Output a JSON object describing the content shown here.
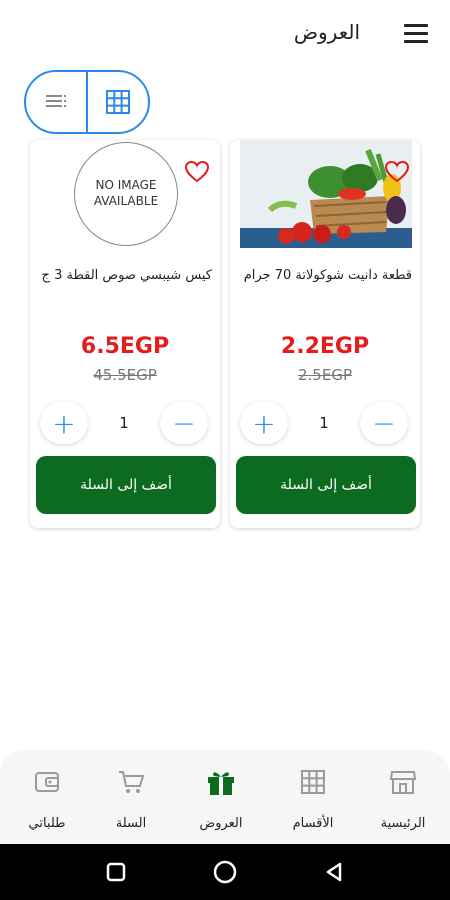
{
  "header": {
    "title": "العروض",
    "menu_icon": "menu-icon"
  },
  "view_toggle": {
    "list_icon": "list-view-icon",
    "grid_icon": "grid-view-icon",
    "active": "grid",
    "accent_color": "#2a8be6"
  },
  "products": [
    {
      "name": "كيس شيبسي صوص القطة 3 ج",
      "image_text": "NO IMAGE AVAILABLE",
      "price": "6.5EGP",
      "old_price": "45.5EGP",
      "quantity": "1",
      "add_label": "أضف إلى السلة",
      "favorite": false
    },
    {
      "name": "قطعة دانيت شوكولاتة 70 جرام",
      "image_text": "",
      "price": "2.2EGP",
      "old_price": "2.5EGP",
      "quantity": "1",
      "add_label": "أضف إلى السلة",
      "favorite": false
    }
  ],
  "bottom_nav": {
    "items": [
      {
        "label": "طلباتي",
        "icon": "wallet-icon",
        "active": false
      },
      {
        "label": "السلة",
        "icon": "cart-icon",
        "active": false
      },
      {
        "label": "العروض",
        "icon": "gift-icon",
        "active": true
      },
      {
        "label": "الأقسام",
        "icon": "categories-grid-icon",
        "active": false
      },
      {
        "label": "الرئيسية",
        "icon": "store-icon",
        "active": false
      }
    ]
  },
  "colors": {
    "primary_green": "#0c6b1f",
    "price_red": "#e31d1d",
    "accent_blue": "#2a8be6"
  }
}
